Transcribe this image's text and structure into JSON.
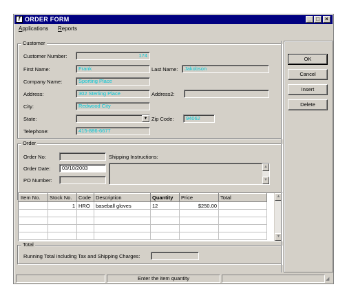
{
  "window": {
    "title": "ORDER FORM",
    "icon": "app-logo-icon",
    "controls": [
      "minimize-icon",
      "maximize-icon",
      "close-icon"
    ]
  },
  "menu": [
    {
      "label": "Applications",
      "mnemonic": "A"
    },
    {
      "label": "Reports",
      "mnemonic": "R"
    }
  ],
  "customer": {
    "group_title": "Customer",
    "customer_number_label": "Customer Number:",
    "customer_number": "174",
    "first_name_label": "First Name:",
    "first_name": "Frank",
    "last_name_label": "Last Name:",
    "last_name": "Jakobson",
    "company_name_label": "Company Name:",
    "company_name": "Sporting Place",
    "address_label": "Address:",
    "address": "302 Sterling Place",
    "address2_label": "Address2:",
    "address2": "",
    "city_label": "City:",
    "city": "Redwood City",
    "state_label": "State:",
    "state": "",
    "zip_label": "Zip Code:",
    "zip": "94062",
    "telephone_label": "Telephone:",
    "telephone": "415-886-6677"
  },
  "order": {
    "group_title": "Order",
    "order_no_label": "Order No:",
    "order_no": "",
    "order_date_label": "Order Date:",
    "order_date": "03/10/2003",
    "po_number_label": "PO Number:",
    "po_number": "",
    "shipping_label": "Shipping Instructions:",
    "shipping": ""
  },
  "items": {
    "columns": [
      "Item No.",
      "Stock No.",
      "Code",
      "Description",
      "Quantity",
      "Price",
      "Total"
    ],
    "rows": [
      [
        "",
        "1",
        "HRO",
        "baseball gloves",
        "12",
        "$250.00",
        ""
      ],
      [
        "",
        "",
        "",
        "",
        "",
        "",
        ""
      ],
      [
        "",
        "",
        "",
        "",
        "",
        "",
        ""
      ],
      [
        "",
        "",
        "",
        "",
        "",
        "",
        ""
      ],
      [
        "",
        "",
        "",
        "",
        "",
        "",
        ""
      ]
    ]
  },
  "total": {
    "group_title": "Total",
    "running_total_label": "Running Total including Tax and Shipping Charges:",
    "running_total": ""
  },
  "buttons": {
    "ok": "OK",
    "cancel": "Cancel",
    "insert": "Insert",
    "delete": "Delete"
  },
  "status": {
    "message": "Enter the item quantity"
  },
  "colors": {
    "titlebar": "#000080",
    "field_text": "#00c8d8",
    "window_bg": "#d4d0c8"
  }
}
